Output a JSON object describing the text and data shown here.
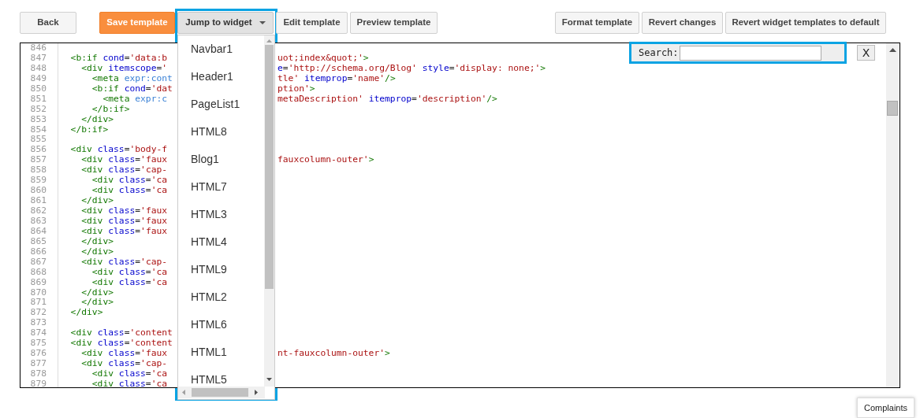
{
  "toolbar": {
    "nav": [
      {
        "label": "Back",
        "kind": "plain"
      }
    ],
    "actions": [
      {
        "label": "Save template",
        "kind": "primary"
      },
      {
        "label": "Jump to widget",
        "kind": "dropdown",
        "expanded": true
      },
      {
        "label": "Edit template",
        "kind": "plain"
      },
      {
        "label": "Preview template",
        "kind": "plain"
      }
    ],
    "right": [
      {
        "label": "Format template",
        "kind": "plain"
      },
      {
        "label": "Revert changes",
        "kind": "plain"
      },
      {
        "label": "Revert widget templates to default",
        "kind": "plain"
      }
    ]
  },
  "widget_menu": {
    "items": [
      "Navbar1",
      "Header1",
      "PageList1",
      "HTML8",
      "Blog1",
      "HTML7",
      "HTML3",
      "HTML4",
      "HTML9",
      "HTML2",
      "HTML6",
      "HTML1",
      "HTML5"
    ]
  },
  "editor": {
    "search": {
      "label": "Search:",
      "close": "X"
    },
    "lines": [
      {
        "number": "846"
      },
      {
        "number": "847",
        "left": "  <b:if cond='data:b",
        "right": "uot;index&quot;'>"
      },
      {
        "number": "848",
        "left": "    <div itemscope='",
        "right": "e='http://schema.org/Blog' style='display: none;'>"
      },
      {
        "number": "849",
        "left": "      <meta expr:cont",
        "right": "tle' itemprop='name'/>"
      },
      {
        "number": "850",
        "left": "      <b:if cond='dat",
        "right": "ption'>"
      },
      {
        "number": "851",
        "left": "        <meta expr:c",
        "right": "metaDescription' itemprop='description'/>"
      },
      {
        "number": "852",
        "left": "      </b:if>"
      },
      {
        "number": "853",
        "left": "    </div>"
      },
      {
        "number": "854",
        "left": "  </b:if>"
      },
      {
        "number": "855"
      },
      {
        "number": "856",
        "left": "  <div class='body-f"
      },
      {
        "number": "857",
        "left": "    <div class='faux",
        "right": "fauxcolumn-outer'>"
      },
      {
        "number": "858",
        "left": "    <div class='cap-"
      },
      {
        "number": "859",
        "left": "      <div class='ca"
      },
      {
        "number": "860",
        "left": "      <div class='ca"
      },
      {
        "number": "861",
        "left": "    </div>"
      },
      {
        "number": "862",
        "left": "    <div class='faux"
      },
      {
        "number": "863",
        "left": "    <div class='faux"
      },
      {
        "number": "864",
        "left": "    <div class='faux"
      },
      {
        "number": "865",
        "left": "    </div>"
      },
      {
        "number": "866",
        "left": "    </div>"
      },
      {
        "number": "867",
        "left": "    <div class='cap-"
      },
      {
        "number": "868",
        "left": "      <div class='ca"
      },
      {
        "number": "869",
        "left": "      <div class='ca"
      },
      {
        "number": "870",
        "left": "    </div>"
      },
      {
        "number": "871",
        "left": "    </div>"
      },
      {
        "number": "872",
        "left": "  </div>"
      },
      {
        "number": "873"
      },
      {
        "number": "874",
        "left": "  <div class='content"
      },
      {
        "number": "875",
        "left": "  <div class='content"
      },
      {
        "number": "876",
        "left": "    <div class='faux",
        "right": "nt-fauxcolumn-outer'>"
      },
      {
        "number": "877",
        "left": "    <div class='cap-"
      },
      {
        "number": "878",
        "left": "      <div class='ca"
      },
      {
        "number": "879",
        "left": "      <div class='ca"
      }
    ]
  },
  "complaints_button": "Complaints"
}
